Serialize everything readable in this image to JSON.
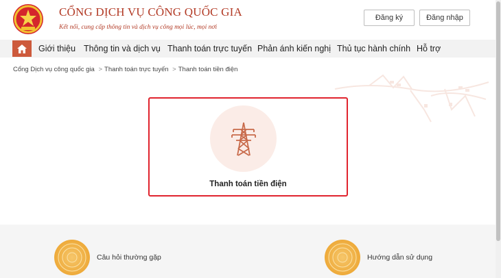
{
  "header": {
    "title": "CỔNG DỊCH VỤ CÔNG QUỐC GIA",
    "subtitle": "Kết nối, cung cấp thông tin và dịch vụ công mọi lúc, mọi nơi",
    "register_label": "Đăng ký",
    "login_label": "Đăng nhập"
  },
  "nav": {
    "items": [
      {
        "label": "Giới thiệu"
      },
      {
        "label": "Thông tin và dịch vụ"
      },
      {
        "label": "Thanh toán trực tuyến"
      },
      {
        "label": "Phản ánh kiến nghị"
      },
      {
        "label": "Thủ tục hành chính"
      },
      {
        "label": "Hỗ trợ"
      }
    ]
  },
  "breadcrumb": {
    "items": [
      "Cổng Dịch vụ công quốc gia",
      "Thanh toán trực tuyến",
      "Thanh toán tiền điện"
    ],
    "separator": ">"
  },
  "card": {
    "title": "Thanh toán tiền điện",
    "icon": "power-tower-icon"
  },
  "help": {
    "faq_label": "Câu hỏi thường gặp",
    "guide_label": "Hướng dẫn sử dụng"
  },
  "colors": {
    "brand": "#b23a25",
    "accent": "#cd5a3c",
    "highlight_border": "#e0232d"
  }
}
